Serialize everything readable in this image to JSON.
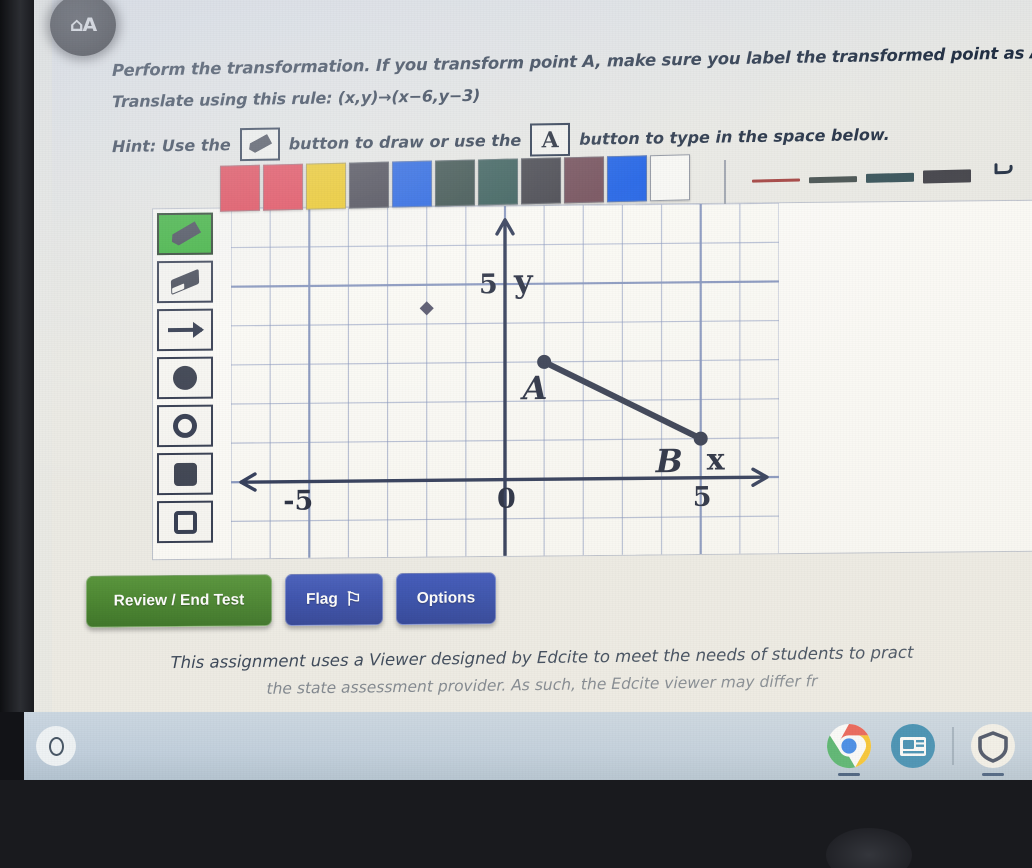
{
  "app": {
    "corner_badge_glyph": "⌂A"
  },
  "question": {
    "line1": "Perform the transformation. If you transform point A, make sure you label the transformed point as A'.",
    "line2": "Translate using this rule: (x,y)→(x−6,y−3)",
    "hint_prefix": "Hint: Use the",
    "hint_middle": "button to draw or use the",
    "hint_suffix": "button to type in the space below.",
    "draw_button_icon": "pencil-icon",
    "text_button_label": "A"
  },
  "palette": {
    "colors": [
      "#e0394a",
      "#e23a4c",
      "#edc513",
      "#3b3a46",
      "#1558e0",
      "#2d4440",
      "#2c534f",
      "#3a3a42",
      "#6b4450",
      "#1158e4",
      "#f7f7f4"
    ],
    "selected_index": 9,
    "line_widths": [
      {
        "name": "thin-line",
        "thickness_px": 3,
        "color": "#a03a38"
      },
      {
        "name": "medium-line",
        "thickness_px": 6,
        "color": "#3f4a49"
      },
      {
        "name": "thick-line",
        "thickness_px": 9,
        "color": "#2e4b52"
      },
      {
        "name": "very-thick-line",
        "thickness_px": 13,
        "color": "#3b3b42"
      }
    ],
    "undo_label": "↺",
    "redo_label": "↻"
  },
  "toolstrip": {
    "items": [
      {
        "name": "pencil-tool",
        "icon": "pencil-icon",
        "active": true
      },
      {
        "name": "eraser-tool",
        "icon": "eraser-icon",
        "active": false
      },
      {
        "name": "line-arrow-tool",
        "icon": "arrow-icon",
        "active": false
      },
      {
        "name": "filled-circle-tool",
        "icon": "filled-circle-icon",
        "active": false
      },
      {
        "name": "open-circle-tool",
        "icon": "open-circle-icon",
        "active": false
      },
      {
        "name": "filled-square-tool",
        "icon": "filled-square-icon",
        "active": false
      },
      {
        "name": "open-square-tool",
        "icon": "open-square-icon",
        "active": false
      }
    ]
  },
  "chart_data": {
    "type": "scatter",
    "title": "",
    "xlabel": "x",
    "ylabel": "y",
    "xlim": [
      -7,
      7
    ],
    "ylim": [
      -2,
      7
    ],
    "grid": true,
    "minor_step": 1,
    "major_step": 5,
    "axis_tick_labels": {
      "x": [
        {
          "value": -5,
          "label": "-5"
        },
        {
          "value": 0,
          "label": "0"
        },
        {
          "value": 5,
          "label": "5"
        }
      ],
      "y": [
        {
          "value": 5,
          "label": "5"
        }
      ]
    },
    "points": [
      {
        "label": "A",
        "x": 1,
        "y": 3,
        "label_dx": -0.55,
        "label_dy": -0.95
      },
      {
        "label": "B",
        "x": 5,
        "y": 1,
        "label_dx": -1.15,
        "label_dy": -0.85
      },
      {
        "label": "",
        "x": -2,
        "y": 4.4,
        "marker": "diamond-small"
      }
    ],
    "segments": [
      {
        "from": "A",
        "to": "B"
      }
    ],
    "grid_color": "#7b8cb8",
    "axis_color": "#25304f",
    "ink_color": "#2a3146"
  },
  "buttons": {
    "review_end_test": "Review / End Test",
    "flag": "Flag",
    "flag_icon": "flag-icon",
    "options": "Options"
  },
  "footer": {
    "line1": "This assignment uses a Viewer designed by Edcite to meet the needs of students to pract",
    "line2": "the state assessment provider. As such, the Edcite viewer may differ fr"
  },
  "shelf": {
    "launcher_icon": "launcher-icon",
    "icons": [
      {
        "name": "chrome-icon"
      },
      {
        "name": "news-app-icon"
      },
      {
        "name": "shield-icon"
      }
    ]
  }
}
